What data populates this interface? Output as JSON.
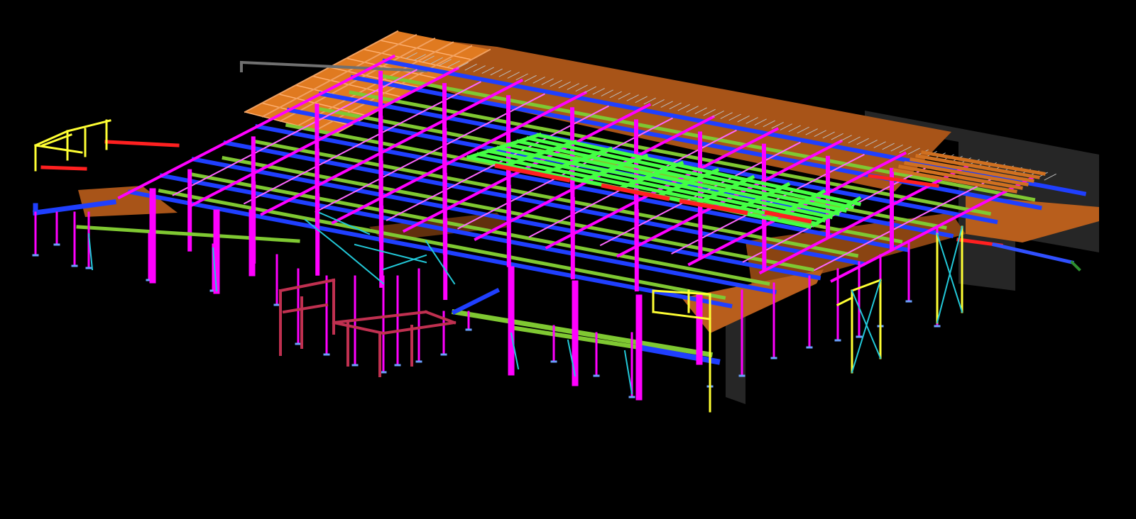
{
  "viewport": {
    "background": "#000000",
    "view": "isometric-3d"
  },
  "model": {
    "type": "structural-steel-frame",
    "colors": {
      "column": "#ff00ff",
      "primary_beam": "#1f3fff",
      "secondary_beam": "#7fc832",
      "secondary_beam_highlight": "#44ff44",
      "brace": "#ff66ff",
      "deck": "#c8691c",
      "deck_dark": "#8a4412",
      "roof_frame": "#e07a20",
      "rail": "#ff2020",
      "stair_frame": "#ffff33",
      "stair_cyan": "#22c8d8",
      "maroon_frame": "#c03050",
      "wall": "#2a2a2a",
      "gray_beam": "#707070"
    }
  }
}
